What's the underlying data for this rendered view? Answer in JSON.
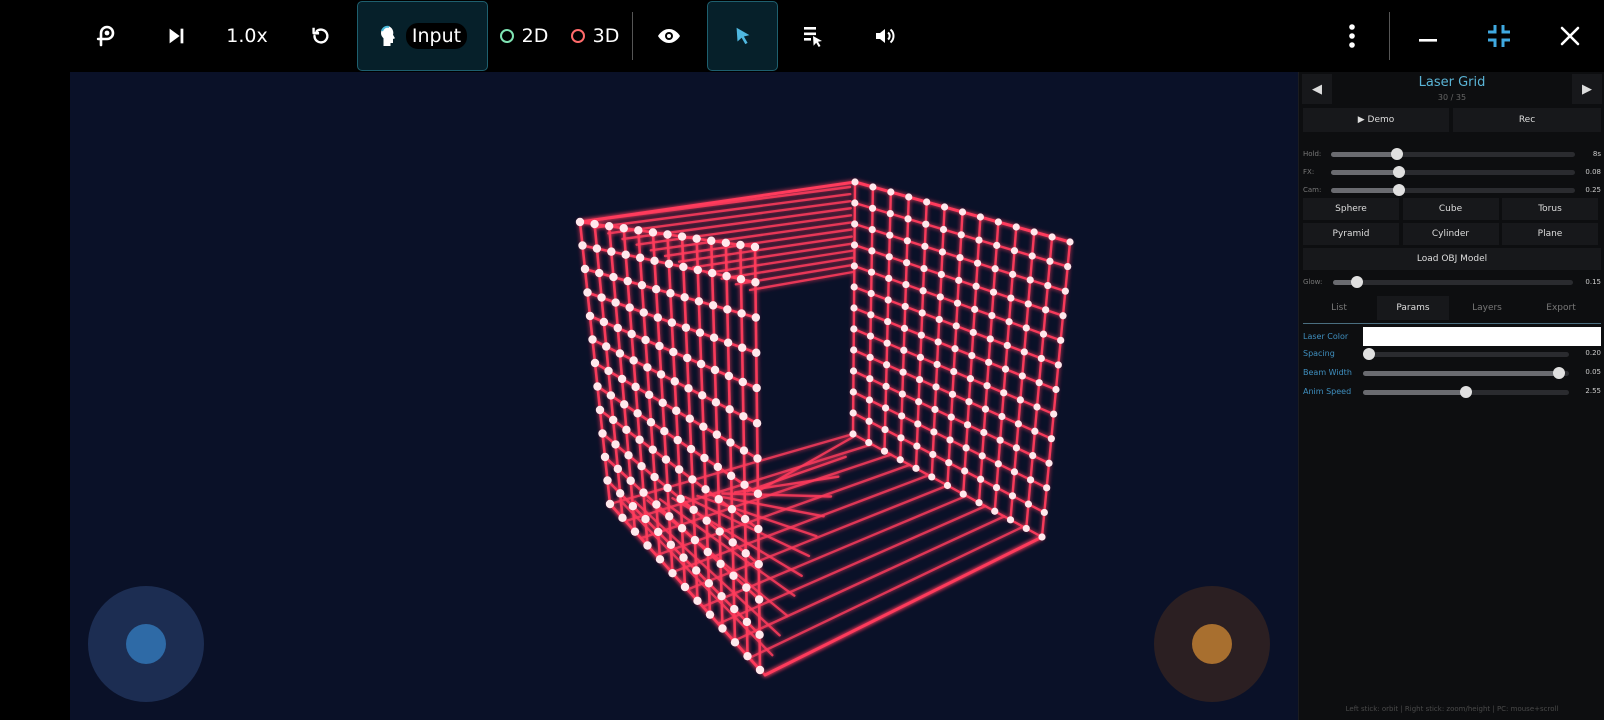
{
  "toolbar": {
    "speed_label": "1.0x",
    "input_label": "Input",
    "mode_2d_label": "2D",
    "mode_3d_label": "3D",
    "colors": {
      "ring_2d": "#7fe3b3",
      "ring_3d": "#ff6b6b",
      "active_bg": "#06202a"
    }
  },
  "viewport": {
    "background": "#0a1128",
    "laser_color": "#ff3b5c",
    "joysticks": {
      "left": {
        "outer": "#1c2d52",
        "inner": "#2e6aa6"
      },
      "right": {
        "outer": "#2b1f22",
        "inner": "#a86f2f"
      }
    }
  },
  "panel": {
    "title": "Laser Grid",
    "counter": "30 / 35",
    "demo_label": "▶ Demo",
    "rec_label": "Rec",
    "sliders": [
      {
        "label": "Hold:",
        "value_text": "8s",
        "fraction": 0.27
      },
      {
        "label": "FX:",
        "value_text": "0.08",
        "fraction": 0.28
      },
      {
        "label": "Cam:",
        "value_text": "0.25",
        "fraction": 0.28
      }
    ],
    "shapes": [
      "Sphere",
      "Cube",
      "Torus",
      "Pyramid",
      "Cylinder",
      "Plane"
    ],
    "load_obj_label": "Load OBJ Model",
    "glow": {
      "label": "Glow:",
      "value_text": "0.15",
      "fraction": 0.1
    },
    "tabs": [
      "List",
      "Params",
      "Layers",
      "Export"
    ],
    "active_tab": "Params",
    "params": {
      "laser_color_label": "Laser Color",
      "laser_color_value": "#ffffff",
      "rows": [
        {
          "label": "Spacing",
          "value_text": "0.20",
          "fraction": 0.03
        },
        {
          "label": "Beam Width",
          "value_text": "0.05",
          "fraction": 0.95
        },
        {
          "label": "Anim Speed",
          "value_text": "2.55",
          "fraction": 0.5
        }
      ]
    },
    "footer": "Left stick: orbit | Right stick: zoom/height | PC: mouse+scroll"
  }
}
